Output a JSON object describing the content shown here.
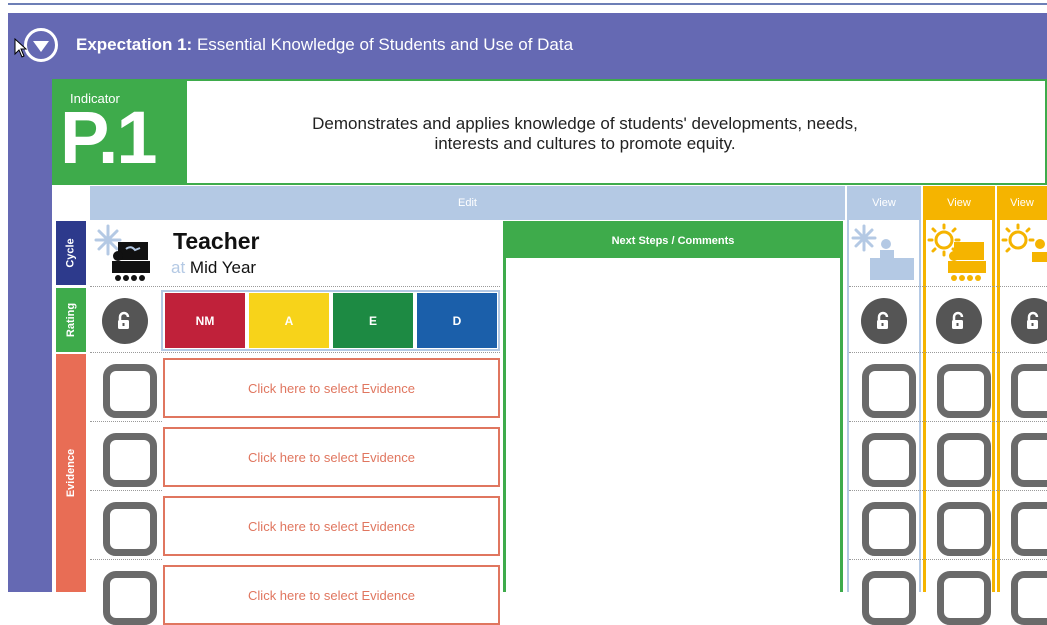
{
  "header": {
    "expectation_label": "Expectation 1:",
    "expectation_title": "Essential Knowledge of Students and Use of Data"
  },
  "indicator": {
    "label": "Indicator",
    "code": "P.1",
    "description_line1": "Demonstrates and applies knowledge of students' developments, needs,",
    "description_line2": "interests and cultures to promote equity."
  },
  "tabs": {
    "cycle": "Cycle",
    "rating": "Rating",
    "evidence": "Evidence"
  },
  "edit_label": "Edit",
  "teacher": {
    "title": "Teacher",
    "at": "at",
    "period": "Mid Year"
  },
  "next_steps": {
    "label": "Next Steps / Comments"
  },
  "ratings": [
    {
      "label": "NM",
      "color": "#c0213a"
    },
    {
      "label": "A",
      "color": "#f7d31a"
    },
    {
      "label": "E",
      "color": "#1d8a43"
    },
    {
      "label": "D",
      "color": "#1b5faa"
    }
  ],
  "evidence": {
    "placeholder": "Click here to select Evidence",
    "rows": [
      "Click here to select Evidence",
      "Click here to select Evidence",
      "Click here to select Evidence",
      "Click here to select Evidence"
    ]
  },
  "view_columns": [
    {
      "label": "View",
      "color": "#b4c9e4",
      "icon": "snowflake-student-icon"
    },
    {
      "label": "View",
      "color": "#f5b400",
      "icon": "sun-teacher-icon"
    },
    {
      "label": "View",
      "color": "#f5b400",
      "icon": "sun-student-icon"
    }
  ],
  "colors": {
    "frame": "#6569b3",
    "indicator_green": "#3eab4b",
    "edit_blue": "#b4c9e4",
    "cycle_tab": "#2d3a8c",
    "evidence_accent": "#e0765f",
    "view_yellow": "#f5b400"
  }
}
